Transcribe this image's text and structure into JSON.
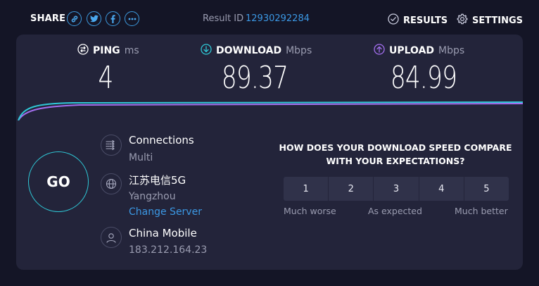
{
  "header": {
    "share_label": "SHARE",
    "share_icons": [
      "link-icon",
      "twitter-icon",
      "facebook-icon",
      "more-icon"
    ],
    "result_id_label": "Result ID",
    "result_id_value": "12930292284",
    "results_label": "RESULTS",
    "settings_label": "SETTINGS"
  },
  "metrics": {
    "ping": {
      "label": "PING",
      "unit": "ms",
      "value": "4",
      "color": "#ffffff"
    },
    "download": {
      "label": "DOWNLOAD",
      "unit": "Mbps",
      "value": "89.37",
      "color": "#2fc8d6"
    },
    "upload": {
      "label": "UPLOAD",
      "unit": "Mbps",
      "value": "84.99",
      "color": "#a46ff0"
    }
  },
  "go_label": "GO",
  "connections": {
    "title": "Connections",
    "value": "Multi"
  },
  "server": {
    "name": "江苏电信5G",
    "location": "Yangzhou",
    "change_label": "Change Server"
  },
  "provider": {
    "name": "China Mobile",
    "ip": "183.212.164.23"
  },
  "feedback": {
    "question": "HOW DOES YOUR DOWNLOAD SPEED COMPARE WITH YOUR EXPECTATIONS?",
    "ratings": [
      "1",
      "2",
      "3",
      "4",
      "5"
    ],
    "low_label": "Much worse",
    "mid_label": "As expected",
    "high_label": "Much better"
  },
  "colors": {
    "accent": "#3b98e4",
    "download": "#2fc8d6",
    "upload": "#a46ff0",
    "card_bg": "#23243a",
    "page_bg": "#141526"
  }
}
